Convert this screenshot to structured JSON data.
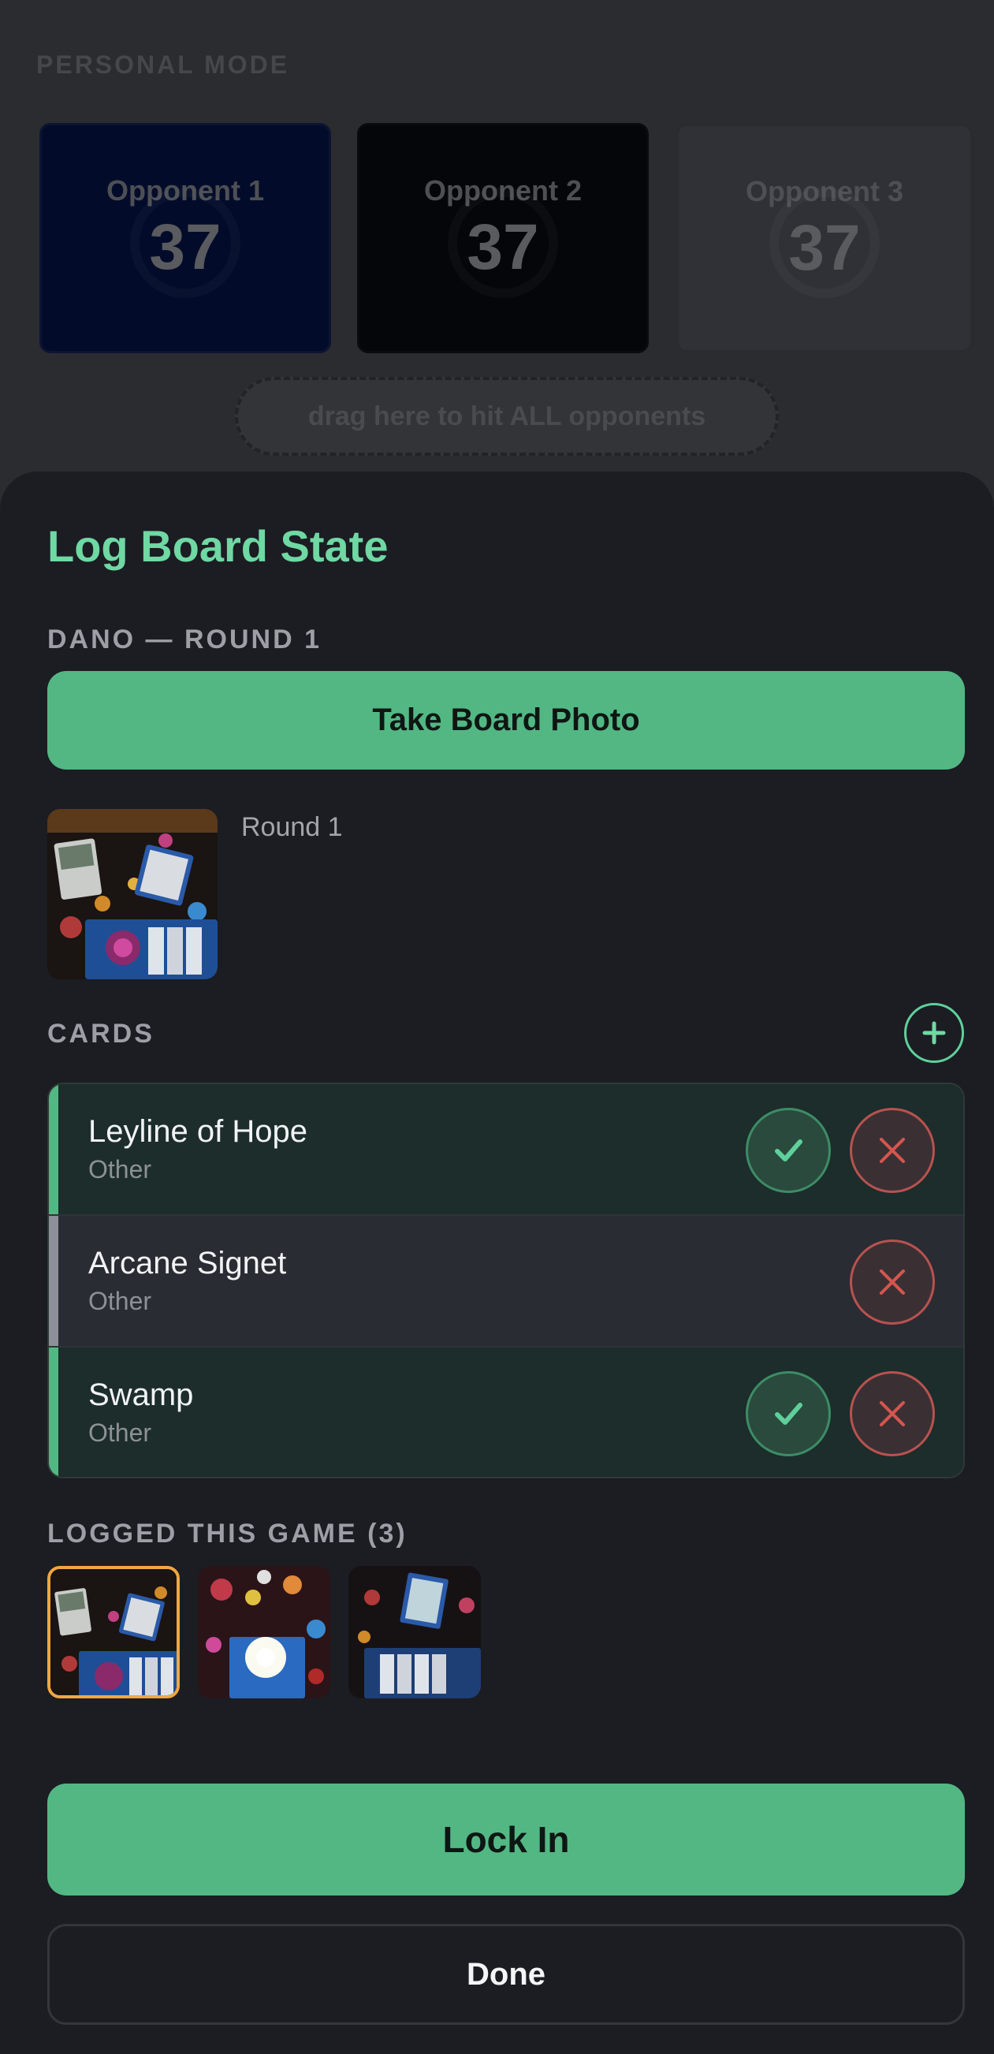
{
  "background": {
    "mode_label": "PERSONAL MODE",
    "opponents": [
      {
        "name": "Opponent 1",
        "life": "37",
        "color": "#020c2a"
      },
      {
        "name": "Opponent 2",
        "life": "37",
        "color": "#050609"
      },
      {
        "name": "Opponent 3",
        "life": "37",
        "color": "#303136"
      }
    ],
    "drop_zone_label": "drag here to hit ALL opponents"
  },
  "sheet": {
    "title": "Log Board State",
    "context_label": "DANO — ROUND 1",
    "take_photo_label": "Take Board Photo",
    "photo_caption": "Round 1",
    "cards_label": "CARDS",
    "add_card_icon": "plus-icon",
    "cards": [
      {
        "name": "Leyline of Hope",
        "type": "Other",
        "status": "accepted"
      },
      {
        "name": "Arcane Signet",
        "type": "Other",
        "status": "pending"
      },
      {
        "name": "Swamp",
        "type": "Other",
        "status": "accepted"
      }
    ],
    "logged_label": "LOGGED THIS GAME (3)",
    "logged_count": 3,
    "lock_in_label": "Lock In",
    "done_label": "Done"
  },
  "colors": {
    "accent": "#53b784",
    "title": "#6fd8a3",
    "reject": "#d5564f",
    "selected_outline": "#f2a640"
  }
}
